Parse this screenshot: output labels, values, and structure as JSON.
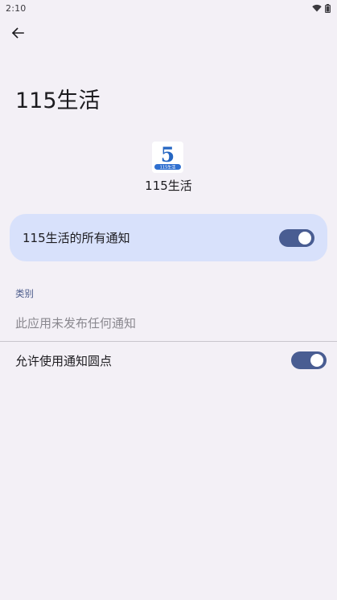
{
  "status_bar": {
    "time": "2:10",
    "icons": [
      "wifi-icon",
      "battery-icon"
    ]
  },
  "header": {
    "back_icon": "arrow-left-icon",
    "title": "115生活"
  },
  "app": {
    "icon_number": "5",
    "icon_caption": "115生活",
    "name": "115生活"
  },
  "all_notifications": {
    "label": "115生活的所有通知",
    "enabled": true
  },
  "categories": {
    "section_label": "类别",
    "empty_text": "此应用未发布任何通知"
  },
  "notification_dot": {
    "label": "允许使用通知圆点",
    "enabled": true
  },
  "colors": {
    "background": "#f3f0f6",
    "card": "#d8e1fb",
    "switch_track": "#495d92",
    "accent_text": "#4a5a8a"
  }
}
